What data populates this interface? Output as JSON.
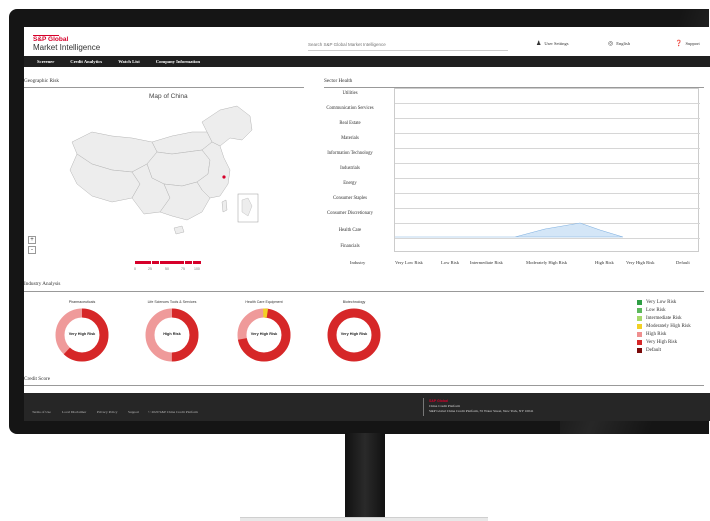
{
  "header": {
    "logo_line1": "S&P Global",
    "logo_line2": "Market Intelligence",
    "search_placeholder": "Search S&P Global Market Intelligence",
    "user_settings": "User Settings",
    "language": "English",
    "support": "Support"
  },
  "nav": {
    "items": [
      "Screener",
      "Credit Analytics",
      "Watch List",
      "Company Information"
    ]
  },
  "geo": {
    "title": "Geographic Risk",
    "map_title": "Map of China",
    "zoom_in": "+",
    "zoom_out": "-",
    "scale_labels": [
      "0",
      "25",
      "50",
      "75",
      "100"
    ]
  },
  "sector": {
    "title": "Sector Health",
    "sectors": [
      "Utilities",
      "Communication Services",
      "Real Estate",
      "Materials",
      "Information Technology",
      "Industrials",
      "Energy",
      "Consumer Staples",
      "Consumer Discretionary",
      "Health Care",
      "Financials"
    ],
    "axis_title": "Industry",
    "risk_levels": [
      "Very Low Risk",
      "Low Risk",
      "Intermediate Risk",
      "Moderately High Risk",
      "High Risk",
      "Very High Risk",
      "Default"
    ],
    "health_care_peak": "Moderately High Risk"
  },
  "industry": {
    "title": "Industry Analysis",
    "donuts": [
      {
        "title": "Pharmaceuticals",
        "label": "Very High Risk",
        "high_share": 0.62
      },
      {
        "title": "Life Sciences Tools & Services",
        "label": "High Risk",
        "high_share": 0.5
      },
      {
        "title": "Health Care Equipment",
        "label": "Very High Risk",
        "high_share": 0.72
      },
      {
        "title": "Biotechnology",
        "label": "Very High Risk",
        "high_share": 1.0
      }
    ],
    "legend": [
      {
        "label": "Very Low Risk",
        "color": "#2e9e44"
      },
      {
        "label": "Low Risk",
        "color": "#5cb85c"
      },
      {
        "label": "Intermediate Risk",
        "color": "#a6d96a"
      },
      {
        "label": "Moderately High Risk",
        "color": "#f2d024"
      },
      {
        "label": "High Risk",
        "color": "#ef8f8f"
      },
      {
        "label": "Very High Risk",
        "color": "#d62728"
      },
      {
        "label": "Default",
        "color": "#7a0a0a"
      }
    ]
  },
  "credit": {
    "title": "Credit Score"
  },
  "footer": {
    "links": [
      "Terms of Use",
      "Local Disclaimer",
      "Privacy Policy",
      "Support",
      "© 2020 S&P China Credit Platform"
    ],
    "right_title": "China Credit Platform",
    "right_address": "S&P Global China Credit Platform, 55 Water Street, New York, NY 10041"
  },
  "colors": {
    "brand_red": "#d6002a",
    "very_high": "#d62728",
    "high": "#ef9a9a",
    "moderately_high": "#f2d024"
  }
}
